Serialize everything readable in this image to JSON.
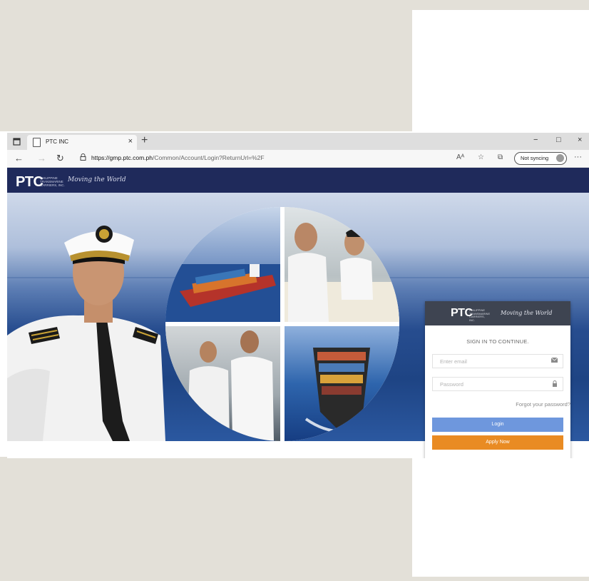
{
  "browser": {
    "tab_title": "PTC INC",
    "tab_close": "×",
    "new_tab": "+",
    "url_host": "https://gmp.ptc.com.ph",
    "url_path": "/Common/Account/Login?ReturnUrl=%2F",
    "sync_label": "Not syncing",
    "window_controls": [
      "−",
      "□",
      "×"
    ]
  },
  "header": {
    "logo": "PTC",
    "logo_subtext": "PHILIPPINE TRANSMARINE CARRIERS, INC.",
    "tagline": "Moving the World"
  },
  "login": {
    "card_logo": "PTC",
    "card_logo_subtext": "PHILIPPINE TRANSMARINE CARRIERS, INC.",
    "card_tagline": "Moving the World",
    "title": "SIGN IN TO CONTINUE.",
    "email_placeholder": "Enter email",
    "password_placeholder": "Password",
    "forgot_label": "Forgot your password?",
    "login_label": "Login",
    "apply_label": "Apply Now"
  },
  "colors": {
    "header_bg": "#1f2a5b",
    "card_header_bg": "#3e4451",
    "login_button": "#6e97dd",
    "apply_button": "#e98b23"
  },
  "icons": {
    "back": "arrow-left-icon",
    "forward": "arrow-right-icon",
    "refresh": "refresh-icon",
    "site_info": "lock-icon",
    "email": "envelope-icon",
    "password": "padlock-icon"
  }
}
